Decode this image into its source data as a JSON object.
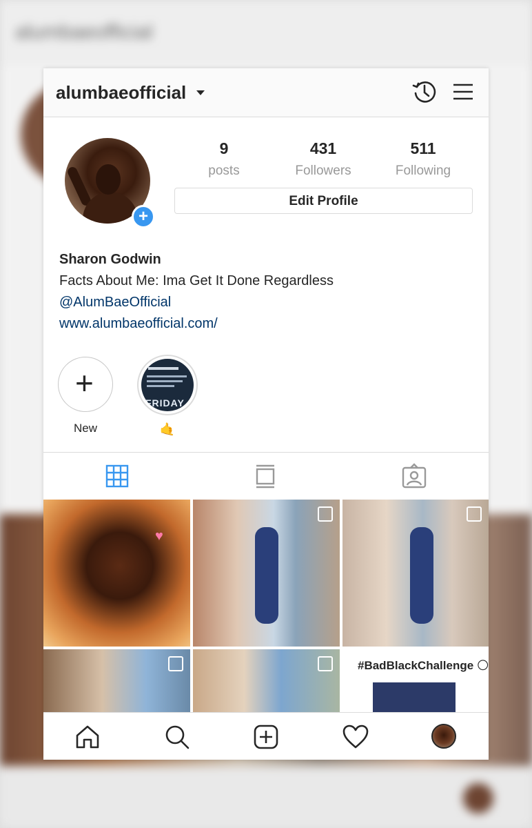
{
  "header": {
    "username": "alumbaeofficial"
  },
  "stats": {
    "posts": {
      "value": "9",
      "label": "posts"
    },
    "followers": {
      "value": "431",
      "label": "Followers"
    },
    "following": {
      "value": "511",
      "label": "Following"
    }
  },
  "profile": {
    "edit_label": "Edit Profile",
    "name": "Sharon Godwin",
    "bio": "Facts About Me: Ima Get It Done Regardless",
    "handle": "@AlumBaeOfficial",
    "website": "www.alumbaeofficial.com/"
  },
  "highlights": [
    {
      "label": "New"
    },
    {
      "label": "🤙",
      "cover_text": "FRIDAY"
    }
  ],
  "tabs": [
    "grid-icon",
    "feed-icon",
    "tagged-icon"
  ],
  "grid": {
    "tile6_caption": "#BadBlackChallenge 🌕"
  },
  "bottom_nav": [
    "home-icon",
    "search-icon",
    "add-post-icon",
    "heart-icon",
    "profile-avatar"
  ],
  "colors": {
    "accent": "#3897f0",
    "link": "#003569",
    "text": "#262626",
    "muted": "#999999"
  }
}
